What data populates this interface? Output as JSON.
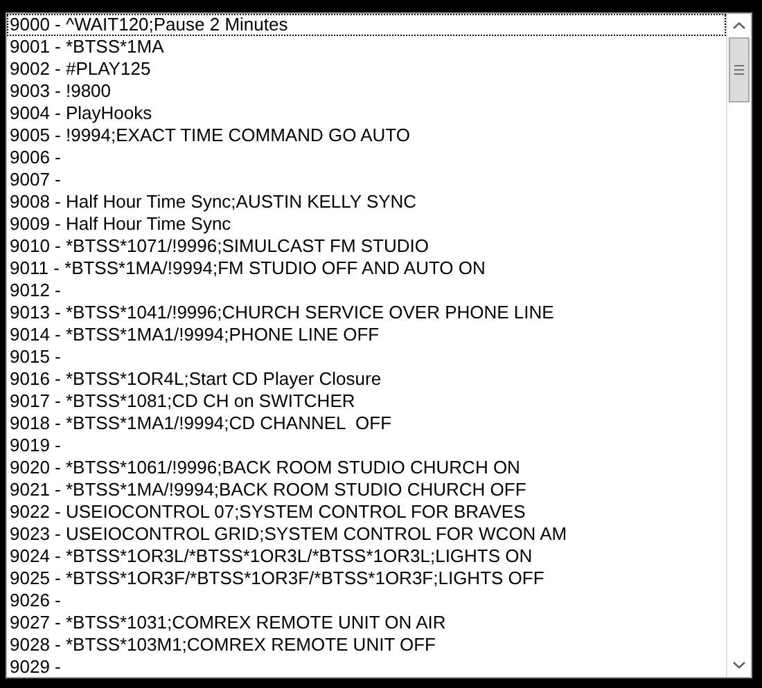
{
  "list": {
    "items": [
      {
        "text": "9000 - ^WAIT120;Pause 2 Minutes",
        "focused": true
      },
      {
        "text": "9001 - *BTSS*1MA",
        "focused": false
      },
      {
        "text": "9002 - #PLAY125",
        "focused": false
      },
      {
        "text": "9003 - !9800",
        "focused": false
      },
      {
        "text": "9004 - PlayHooks",
        "focused": false
      },
      {
        "text": "9005 - !9994;EXACT TIME COMMAND GO AUTO",
        "focused": false
      },
      {
        "text": "9006 -",
        "focused": false
      },
      {
        "text": "9007 -",
        "focused": false
      },
      {
        "text": "9008 - Half Hour Time Sync;AUSTIN KELLY SYNC",
        "focused": false
      },
      {
        "text": "9009 - Half Hour Time Sync",
        "focused": false
      },
      {
        "text": "9010 - *BTSS*1071/!9996;SIMULCAST FM STUDIO",
        "focused": false
      },
      {
        "text": "9011 - *BTSS*1MA/!9994;FM STUDIO OFF AND AUTO ON",
        "focused": false
      },
      {
        "text": "9012 -",
        "focused": false
      },
      {
        "text": "9013 - *BTSS*1041/!9996;CHURCH SERVICE OVER PHONE LINE",
        "focused": false
      },
      {
        "text": "9014 - *BTSS*1MA1/!9994;PHONE LINE OFF",
        "focused": false
      },
      {
        "text": "9015 -",
        "focused": false
      },
      {
        "text": "9016 - *BTSS*1OR4L;Start CD Player Closure",
        "focused": false
      },
      {
        "text": "9017 - *BTSS*1081;CD CH on SWITCHER",
        "focused": false
      },
      {
        "text": "9018 - *BTSS*1MA1/!9994;CD CHANNEL  OFF",
        "focused": false
      },
      {
        "text": "9019 -",
        "focused": false
      },
      {
        "text": "9020 - *BTSS*1061/!9996;BACK ROOM STUDIO CHURCH ON",
        "focused": false
      },
      {
        "text": "9021 - *BTSS*1MA/!9994;BACK ROOM STUDIO CHURCH OFF",
        "focused": false
      },
      {
        "text": "9022 - USEIOCONTROL 07;SYSTEM CONTROL FOR BRAVES",
        "focused": false
      },
      {
        "text": "9023 - USEIOCONTROL GRID;SYSTEM CONTROL FOR WCON AM",
        "focused": false
      },
      {
        "text": "9024 - *BTSS*1OR3L/*BTSS*1OR3L/*BTSS*1OR3L;LIGHTS ON",
        "focused": false
      },
      {
        "text": "9025 - *BTSS*1OR3F/*BTSS*1OR3F/*BTSS*1OR3F;LIGHTS OFF",
        "focused": false
      },
      {
        "text": "9026 -",
        "focused": false
      },
      {
        "text": "9027 - *BTSS*1031;COMREX REMOTE UNIT ON AIR",
        "focused": false
      },
      {
        "text": "9028 - *BTSS*103M1;COMREX REMOTE UNIT OFF",
        "focused": false
      },
      {
        "text": "9029 -",
        "focused": false
      }
    ]
  }
}
